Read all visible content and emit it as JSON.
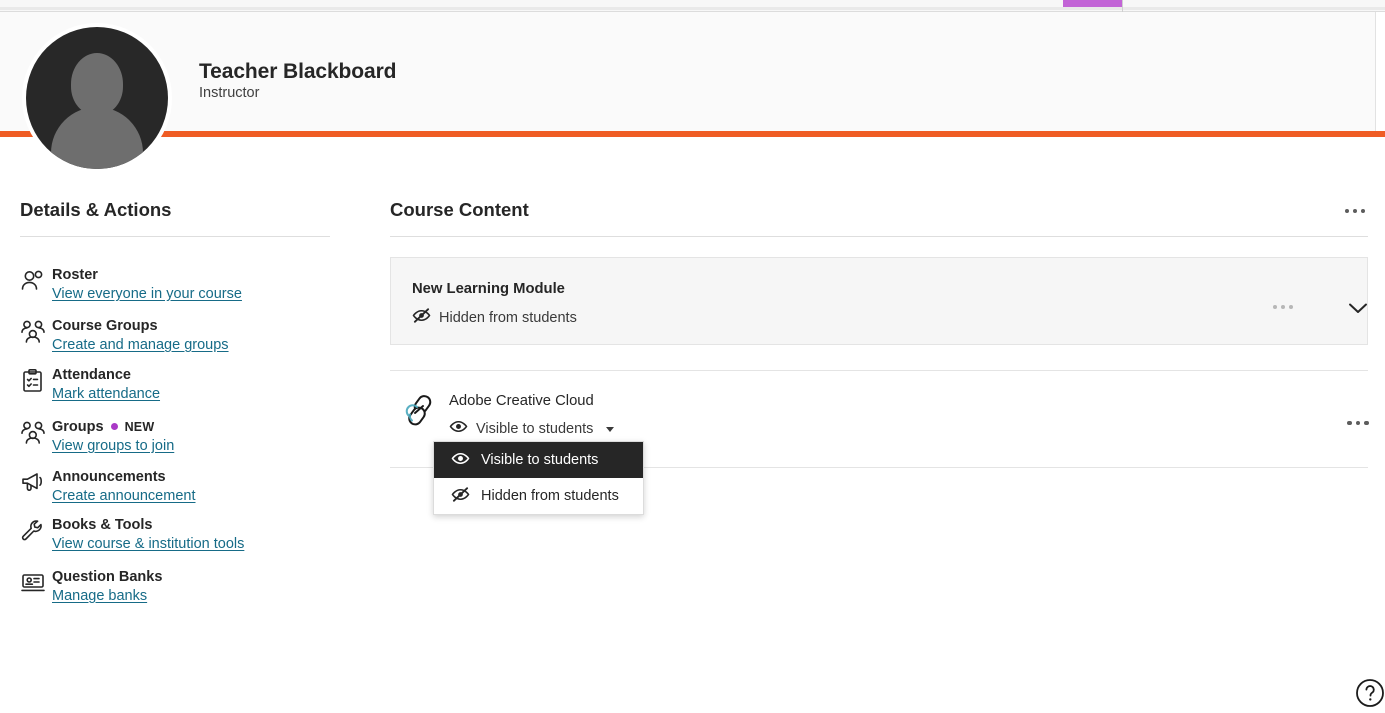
{
  "browser": {
    "tab_indicator_color": "#c264d6"
  },
  "theme": {
    "accent_orange": "#ef5c24",
    "link_teal": "#166b87",
    "new_badge_purple": "#a939c6",
    "selected_dark": "#262626"
  },
  "profile": {
    "name": "Teacher Blackboard",
    "role": "Instructor",
    "avatar_icon": "user-avatar-placeholder"
  },
  "sidebar": {
    "title": "Details & Actions",
    "items": [
      {
        "icon": "roster-person-icon",
        "label": "Roster",
        "link": "View everyone in your course",
        "badge": null
      },
      {
        "icon": "course-groups-people-icon",
        "label": "Course Groups",
        "link": "Create and manage groups",
        "badge": null
      },
      {
        "icon": "attendance-clipboard-icon",
        "label": "Attendance",
        "link": "Mark attendance",
        "badge": null
      },
      {
        "icon": "groups-people-icon",
        "label": "Groups",
        "link": "View groups to join",
        "badge": "NEW"
      },
      {
        "icon": "announcements-megaphone-icon",
        "label": "Announcements",
        "link": "Create announcement",
        "badge": null
      },
      {
        "icon": "books-tools-wrench-icon",
        "label": "Books & Tools",
        "link": "View course & institution tools",
        "badge": null
      },
      {
        "icon": "question-banks-icon",
        "label": "Question Banks",
        "link": "Manage banks",
        "badge": null
      }
    ]
  },
  "main": {
    "title": "Course Content",
    "overflow_menu_icon": "kebab-menu-icon",
    "module": {
      "title": "New Learning Module",
      "status_icon": "eye-slash-icon",
      "status": "Hidden from students",
      "overflow_menu_icon": "kebab-menu-icon",
      "expand_icon": "chevron-down-icon"
    },
    "link_item": {
      "icon": "chain-link-icon",
      "title": "Adobe Creative Cloud",
      "visibility_icon": "eye-icon",
      "visibility": "Visible to students",
      "caret_icon": "caret-down-icon",
      "overflow_menu_icon": "kebab-menu-icon"
    },
    "visibility_dropdown": {
      "open": true,
      "options": [
        {
          "icon": "eye-icon",
          "label": "Visible to students",
          "selected": true
        },
        {
          "icon": "eye-slash-icon",
          "label": "Hidden from students",
          "selected": false
        }
      ]
    }
  },
  "help": {
    "icon": "question-circle-icon",
    "label": "Help"
  }
}
